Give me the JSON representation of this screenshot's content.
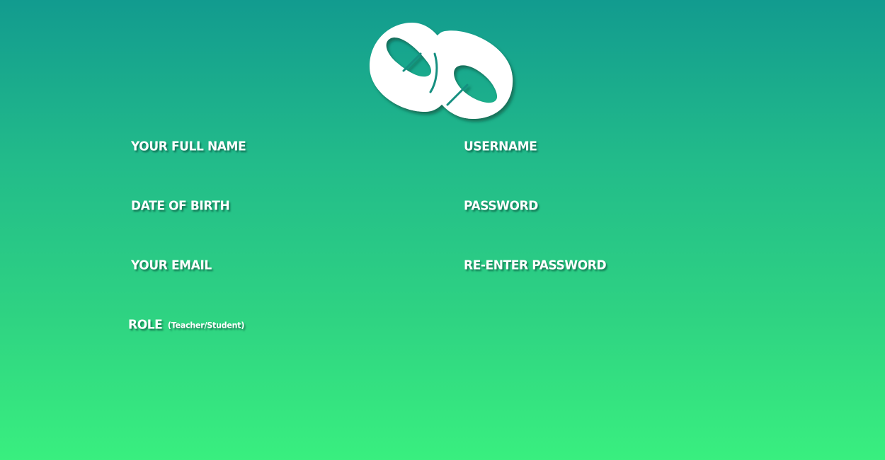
{
  "brand": {
    "logo_icon": "interlocking-rings-logo"
  },
  "form": {
    "full_name_label": "YOUR FULL NAME",
    "full_name_value": "",
    "username_label": "USERNAME",
    "username_value": "",
    "dob_label": "DATE OF BIRTH",
    "dob_value": "",
    "password_label": "PASSWORD",
    "password_value": "",
    "email_label": "YOUR EMAIL",
    "email_value": "",
    "reenter_password_label": "RE-ENTER PASSWORD",
    "reenter_password_value": "",
    "role_label": "ROLE",
    "role_hint": "(Teacher/Student)",
    "role_value": ""
  },
  "colors": {
    "gradient_top": "#129b8f",
    "gradient_bottom": "#39ef7f",
    "label_text": "#ffffff",
    "logo_fill": "#ffffff"
  }
}
